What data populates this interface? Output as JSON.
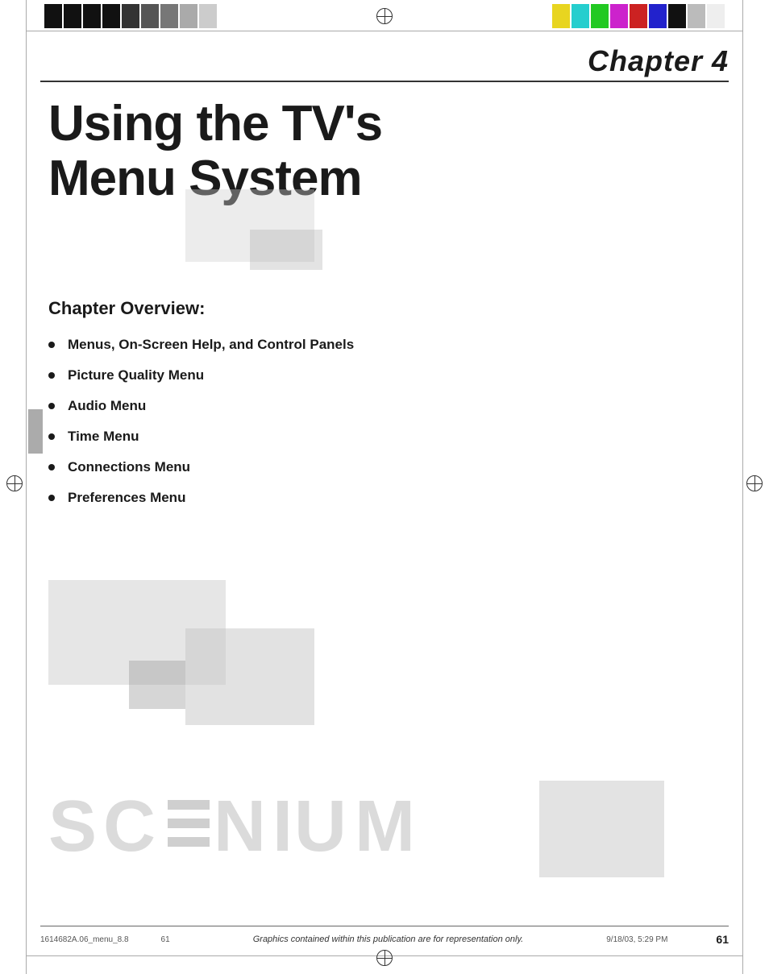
{
  "page": {
    "chapter_label": "Chapter 4",
    "main_title_line1": "Using the TV's",
    "main_title_line2": "Menu System",
    "overview_heading": "Chapter Overview:",
    "bullet_items": [
      "Menus, On-Screen Help, and Control Panels",
      "Picture Quality Menu",
      "Audio Menu",
      "Time Menu",
      "Connections Menu",
      "Preferences Menu"
    ],
    "scenium_logo": "SC≡NIUM",
    "footer_disclaimer": "Graphics contained within this publication are for representation only.",
    "footer_doc_id": "1614682A.06_menu_8.8",
    "footer_page_num": "61",
    "footer_center_num": "61",
    "footer_date": "9/18/03, 5:29 PM"
  },
  "color_bars_left": [
    {
      "color": "#1a1a1a"
    },
    {
      "color": "#1a1a1a"
    },
    {
      "color": "#1a1a1a"
    },
    {
      "color": "#1a1a1a"
    },
    {
      "color": "#1a1a1a"
    },
    {
      "color": "#555555"
    },
    {
      "color": "#888888"
    },
    {
      "color": "#bbbbbb"
    },
    {
      "color": "#dddddd"
    }
  ],
  "color_bars_right": [
    {
      "color": "#f5e642"
    },
    {
      "color": "#33cccc"
    },
    {
      "color": "#33cc33"
    },
    {
      "color": "#cc33cc"
    },
    {
      "color": "#cc3333"
    },
    {
      "color": "#3333cc"
    },
    {
      "color": "#1a1a1a"
    },
    {
      "color": "#cccccc"
    },
    {
      "color": "#f0f0f0"
    }
  ]
}
